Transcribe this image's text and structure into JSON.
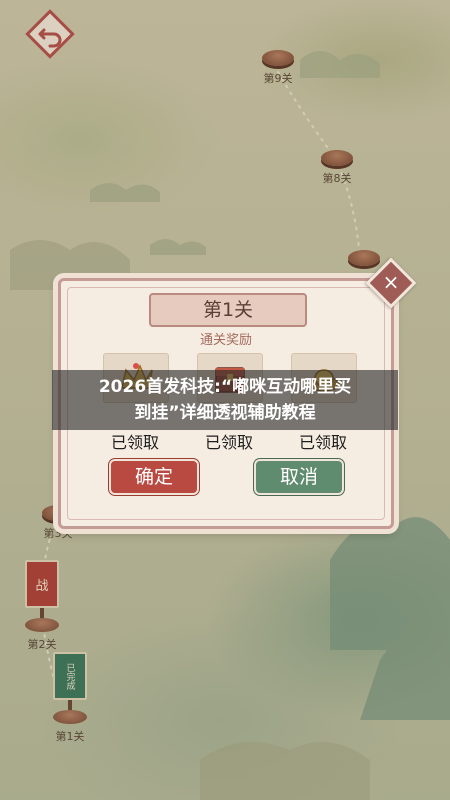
{
  "map": {
    "stages": [
      {
        "label": "第9关"
      },
      {
        "label": "第8关"
      },
      {
        "label": "第3关"
      },
      {
        "label": "第2关"
      },
      {
        "label": "第1关"
      }
    ],
    "flags": [
      {
        "text": "战",
        "color": "#b2443a"
      },
      {
        "text": "已完成",
        "color": "#3f7a5e"
      }
    ]
  },
  "dialog": {
    "title": "第1关",
    "subtitle": "通关奖励",
    "rewards": [
      {
        "icon": "crown-treasure-icon",
        "status": "已领取"
      },
      {
        "icon": "treasure-chest-icon",
        "status": "已领取"
      },
      {
        "icon": "gold-ingot-icon",
        "status": "已领取"
      }
    ],
    "confirm_label": "确定",
    "cancel_label": "取消",
    "close_symbol": "×"
  },
  "banner": {
    "line1": "2026首发科技:“嘟咪互动哪里买",
    "line2": "到挂”详细透视辅助教程"
  },
  "colors": {
    "confirm": "#b94a42",
    "cancel": "#5f8b6f",
    "close": "#9f5c56"
  }
}
